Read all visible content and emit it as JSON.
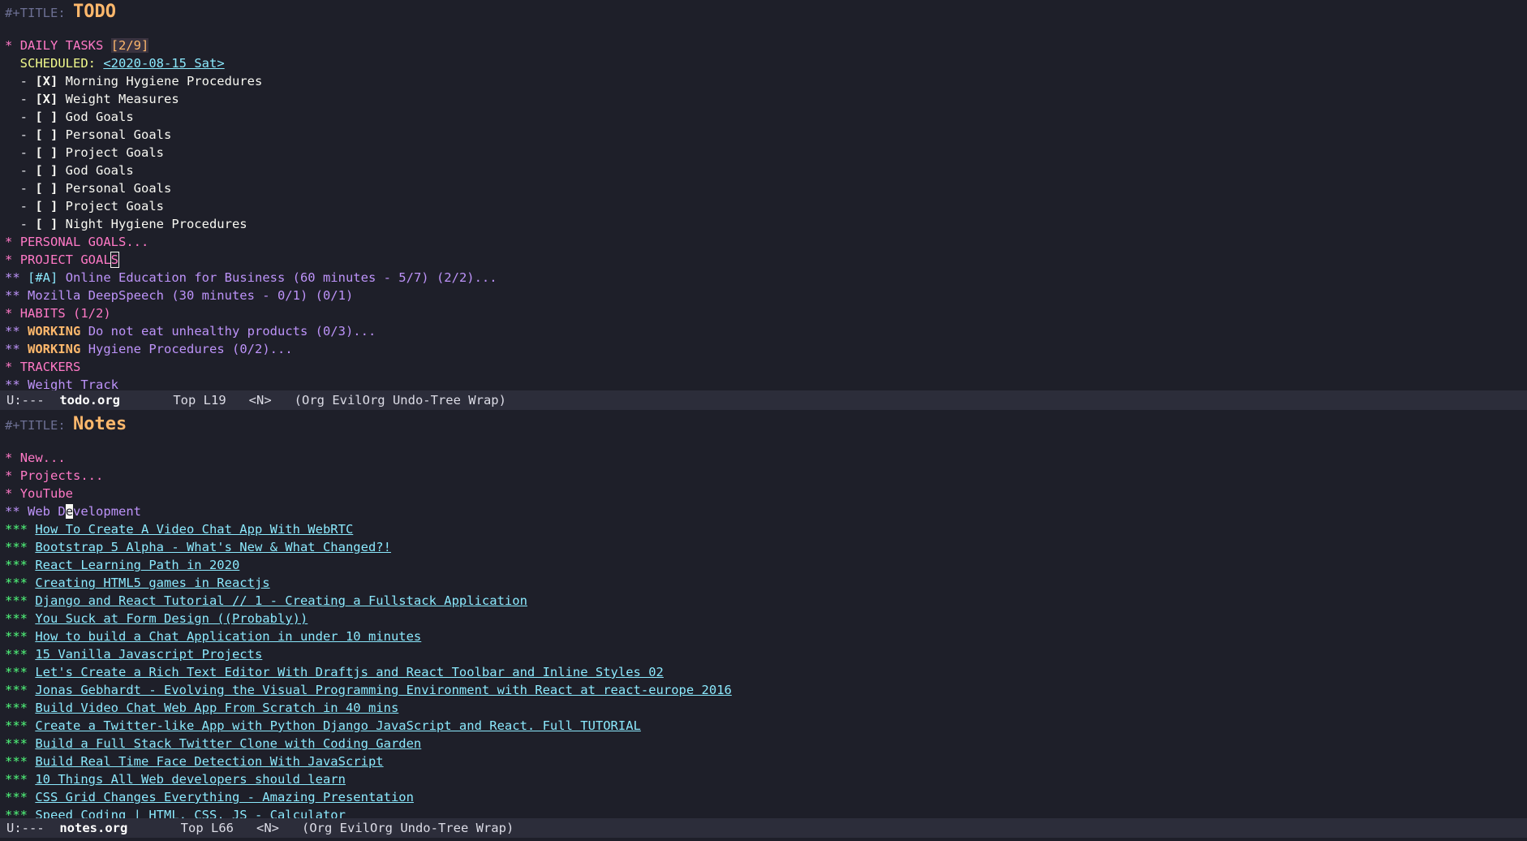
{
  "todo": {
    "title_keyword": "#+TITLE:",
    "title": "TODO",
    "daily": {
      "stars": "*",
      "heading": "DAILY TASKS",
      "cookie": "[2/9]",
      "scheduled_kw": "SCHEDULED:",
      "scheduled_date": "<2020-08-15 Sat>",
      "items": [
        {
          "box": "[X]",
          "text": "Morning Hygiene Procedures"
        },
        {
          "box": "[X]",
          "text": "Weight Measures"
        },
        {
          "box": "[ ]",
          "text": "God Goals"
        },
        {
          "box": "[ ]",
          "text": "Personal Goals"
        },
        {
          "box": "[ ]",
          "text": "Project Goals"
        },
        {
          "box": "[ ]",
          "text": "God Goals"
        },
        {
          "box": "[ ]",
          "text": "Personal Goals"
        },
        {
          "box": "[ ]",
          "text": "Project Goals"
        },
        {
          "box": "[ ]",
          "text": "Night Hygiene Procedures"
        }
      ]
    },
    "personal_goals": {
      "stars": "*",
      "heading": "PERSONAL GOALS..."
    },
    "project_goals": {
      "stars": "*",
      "heading_a": "PROJECT GOAL",
      "heading_cursor": "S"
    },
    "project_items": [
      {
        "stars": "**",
        "priority": "[#A]",
        "text": "Online Education for Business (60 minutes - 5/7) (2/2)..."
      },
      {
        "stars": "**",
        "priority": "",
        "text": "Mozilla DeepSpeech (30 minutes - 0/1) (0/1)"
      }
    ],
    "habits": {
      "stars": "*",
      "heading": "HABITS (1/2)"
    },
    "habit_items": [
      {
        "stars": "**",
        "state": "WORKING",
        "text": "Do not eat unhealthy products (0/3)..."
      },
      {
        "stars": "**",
        "state": "WORKING",
        "text": "Hygiene Procedures (0/2)..."
      }
    ],
    "trackers": {
      "stars": "*",
      "heading": "TRACKERS"
    },
    "cut_line": {
      "stars": "**",
      "text": "Weight Track"
    }
  },
  "modeline_top": {
    "state": "U:---",
    "buffer": "todo.org",
    "position": "Top L19",
    "evil": "<N>",
    "modes": "(Org EvilOrg Undo-Tree Wrap)"
  },
  "notes": {
    "title_keyword": "#+TITLE:",
    "title": "Notes",
    "top_headings": [
      {
        "stars": "*",
        "text": "New..."
      },
      {
        "stars": "*",
        "text": "Projects..."
      },
      {
        "stars": "*",
        "text": "YouTube"
      }
    ],
    "webdev": {
      "stars": "**",
      "text_a": "Web D",
      "text_cursor": "e",
      "text_b": "velopment"
    },
    "links": [
      "How To Create A Video Chat App With WebRTC",
      "Bootstrap 5 Alpha - What's New & What Changed?!",
      "React Learning Path in 2020",
      "Creating HTML5 games in Reactjs",
      "Django and React Tutorial // 1 - Creating a Fullstack Application",
      "You Suck at Form Design ((Probably))",
      "How to build a Chat Application in under 10 minutes",
      "15 Vanilla Javascript Projects",
      "Let's Create a Rich Text Editor With Draftjs and React Toolbar and Inline Styles 02",
      "Jonas Gebhardt - Evolving the Visual Programming Environment with React at react-europe 2016",
      "Build Video Chat Web App From Scratch in 40 mins",
      "Create a Twitter-like App with Python Django JavaScript and React. Full TUTORIAL",
      "Build a Full Stack Twitter Clone with Coding Garden",
      "Build Real Time Face Detection With JavaScript",
      "10 Things All Web developers should learn",
      "CSS Grid Changes Everything - Amazing Presentation",
      "Speed Coding | HTML, CSS, JS - Calculator"
    ],
    "link_stars": "***"
  },
  "modeline_bottom": {
    "state": "U:---",
    "buffer": "notes.org",
    "position": "Top L66",
    "evil": "<N>",
    "modes": "(Org EvilOrg Undo-Tree Wrap)"
  },
  "colors": {
    "background": "#1e1f29",
    "heading1": "#ff79c6",
    "heading2": "#bd93f9",
    "heading3": "#50fa7b",
    "title": "#ffb86c",
    "link": "#8be9fd",
    "modeline": "#2c2d3a"
  }
}
